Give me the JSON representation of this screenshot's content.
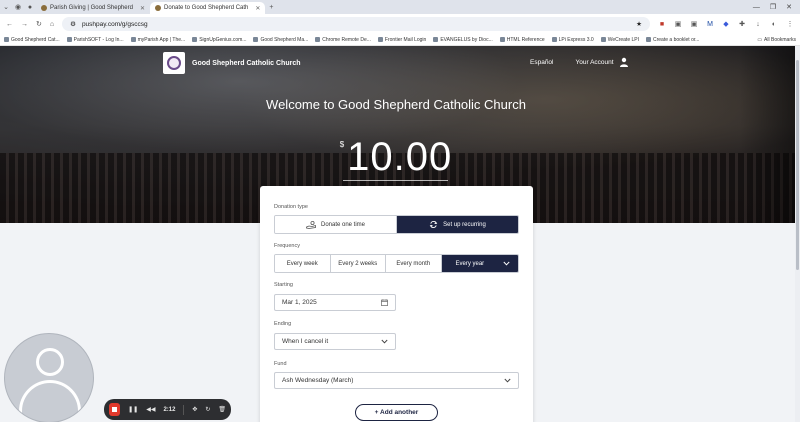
{
  "browser": {
    "tabs": [
      {
        "label": "Parish Giving | Good Shepherd",
        "active": false
      },
      {
        "label": "Donate to Good Shepherd Cath",
        "active": true
      }
    ],
    "new_tab": "+",
    "url": "pushpay.com/g/gsccsg",
    "bookmarks": [
      "Good Shepherd Cat...",
      "ParishSOFT - Log In...",
      "myParish App | The...",
      "SignUpGenius.com...",
      "Good Shepherd Ma...",
      "Chrome Remote De...",
      "Frontier Mail Login",
      "EVANGELUS by Dioc...",
      "HTML Reference",
      "LPi Express 3.0",
      "WeCreate LPI",
      "Create a booklet or..."
    ],
    "all_bookmarks": "All Bookmarks"
  },
  "site": {
    "church_name": "Good Shepherd Catholic Church",
    "nav_spanish": "Español",
    "nav_account": "Your Account"
  },
  "hero": {
    "welcome": "Welcome to Good Shepherd Catholic Church",
    "currency": "$",
    "amount": "10.00"
  },
  "form": {
    "donation_type_label": "Donation type",
    "donation_types": [
      "Donate one time",
      "Set up recurring"
    ],
    "donation_type_selected": "Set up recurring",
    "frequency_label": "Frequency",
    "frequencies": [
      "Every week",
      "Every 2 weeks",
      "Every month",
      "Every year"
    ],
    "frequency_selected": "Every year",
    "starting_label": "Starting",
    "starting_value": "Mar 1, 2025",
    "ending_label": "Ending",
    "ending_value": "When I cancel it",
    "fund_label": "Fund",
    "fund_value": "Ash Wednesday (March)",
    "add_another": "+ Add another"
  },
  "recorder": {
    "time": "2:12"
  },
  "colors": {
    "accent_navy": "#1d2442",
    "record_red": "#e0392c"
  }
}
